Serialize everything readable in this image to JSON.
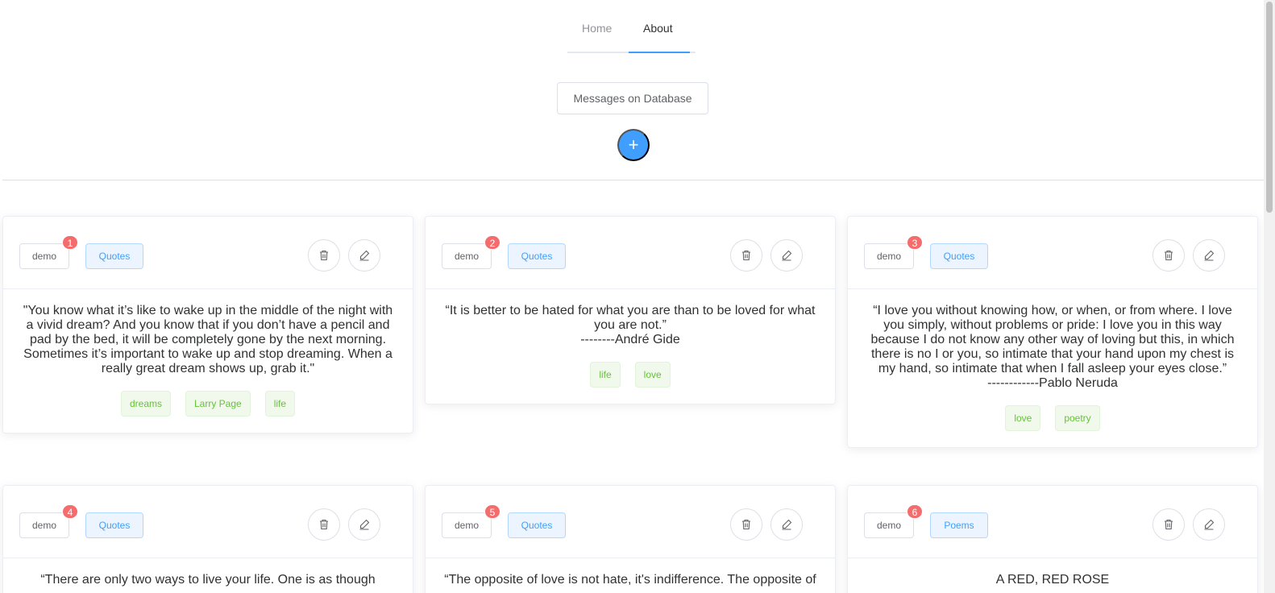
{
  "nav": {
    "tabs": [
      {
        "label": "Home",
        "active": false
      },
      {
        "label": "About",
        "active": true
      }
    ]
  },
  "header": {
    "db_button_label": "Messages on Database",
    "add_button_label": "+"
  },
  "colors": {
    "primary": "#409eff",
    "badge": "#f56c6c",
    "success_text": "#67c23a"
  },
  "cards": [
    {
      "user": "demo",
      "badge": "1",
      "category": "Quotes",
      "text": "\"You know what it’s like to wake up in the middle of the night with a vivid dream? And you know that if you don’t have a pencil and pad by the bed, it will be completely gone by the next morning. Sometimes it’s important to wake up and stop dreaming. When a really great dream shows up, grab it.\"",
      "tags": [
        "dreams",
        "Larry Page",
        "life"
      ]
    },
    {
      "user": "demo",
      "badge": "2",
      "category": "Quotes",
      "text": "“It is better to be hated for what you are than to be loved for what you are not.”\n--------André Gide",
      "tags": [
        "life",
        "love"
      ]
    },
    {
      "user": "demo",
      "badge": "3",
      "category": "Quotes",
      "text": "“I love you without knowing how, or when, or from where. I love you simply, without problems or pride: I love you in this way because I do not know any other way of loving but this, in which there is no I or you, so intimate that your hand upon my chest is my hand, so intimate that when I fall asleep your eyes close.”\n------------Pablo Neruda",
      "tags": [
        "love",
        "poetry"
      ]
    },
    {
      "user": "demo",
      "badge": "4",
      "category": "Quotes",
      "text": "“There are only two ways to live your life. One is as though",
      "tags": []
    },
    {
      "user": "demo",
      "badge": "5",
      "category": "Quotes",
      "text": "“The opposite of love is not hate, it's indifference. The opposite of",
      "tags": []
    },
    {
      "user": "demo",
      "badge": "6",
      "category": "Poems",
      "text": "A RED, RED ROSE",
      "tags": []
    }
  ]
}
